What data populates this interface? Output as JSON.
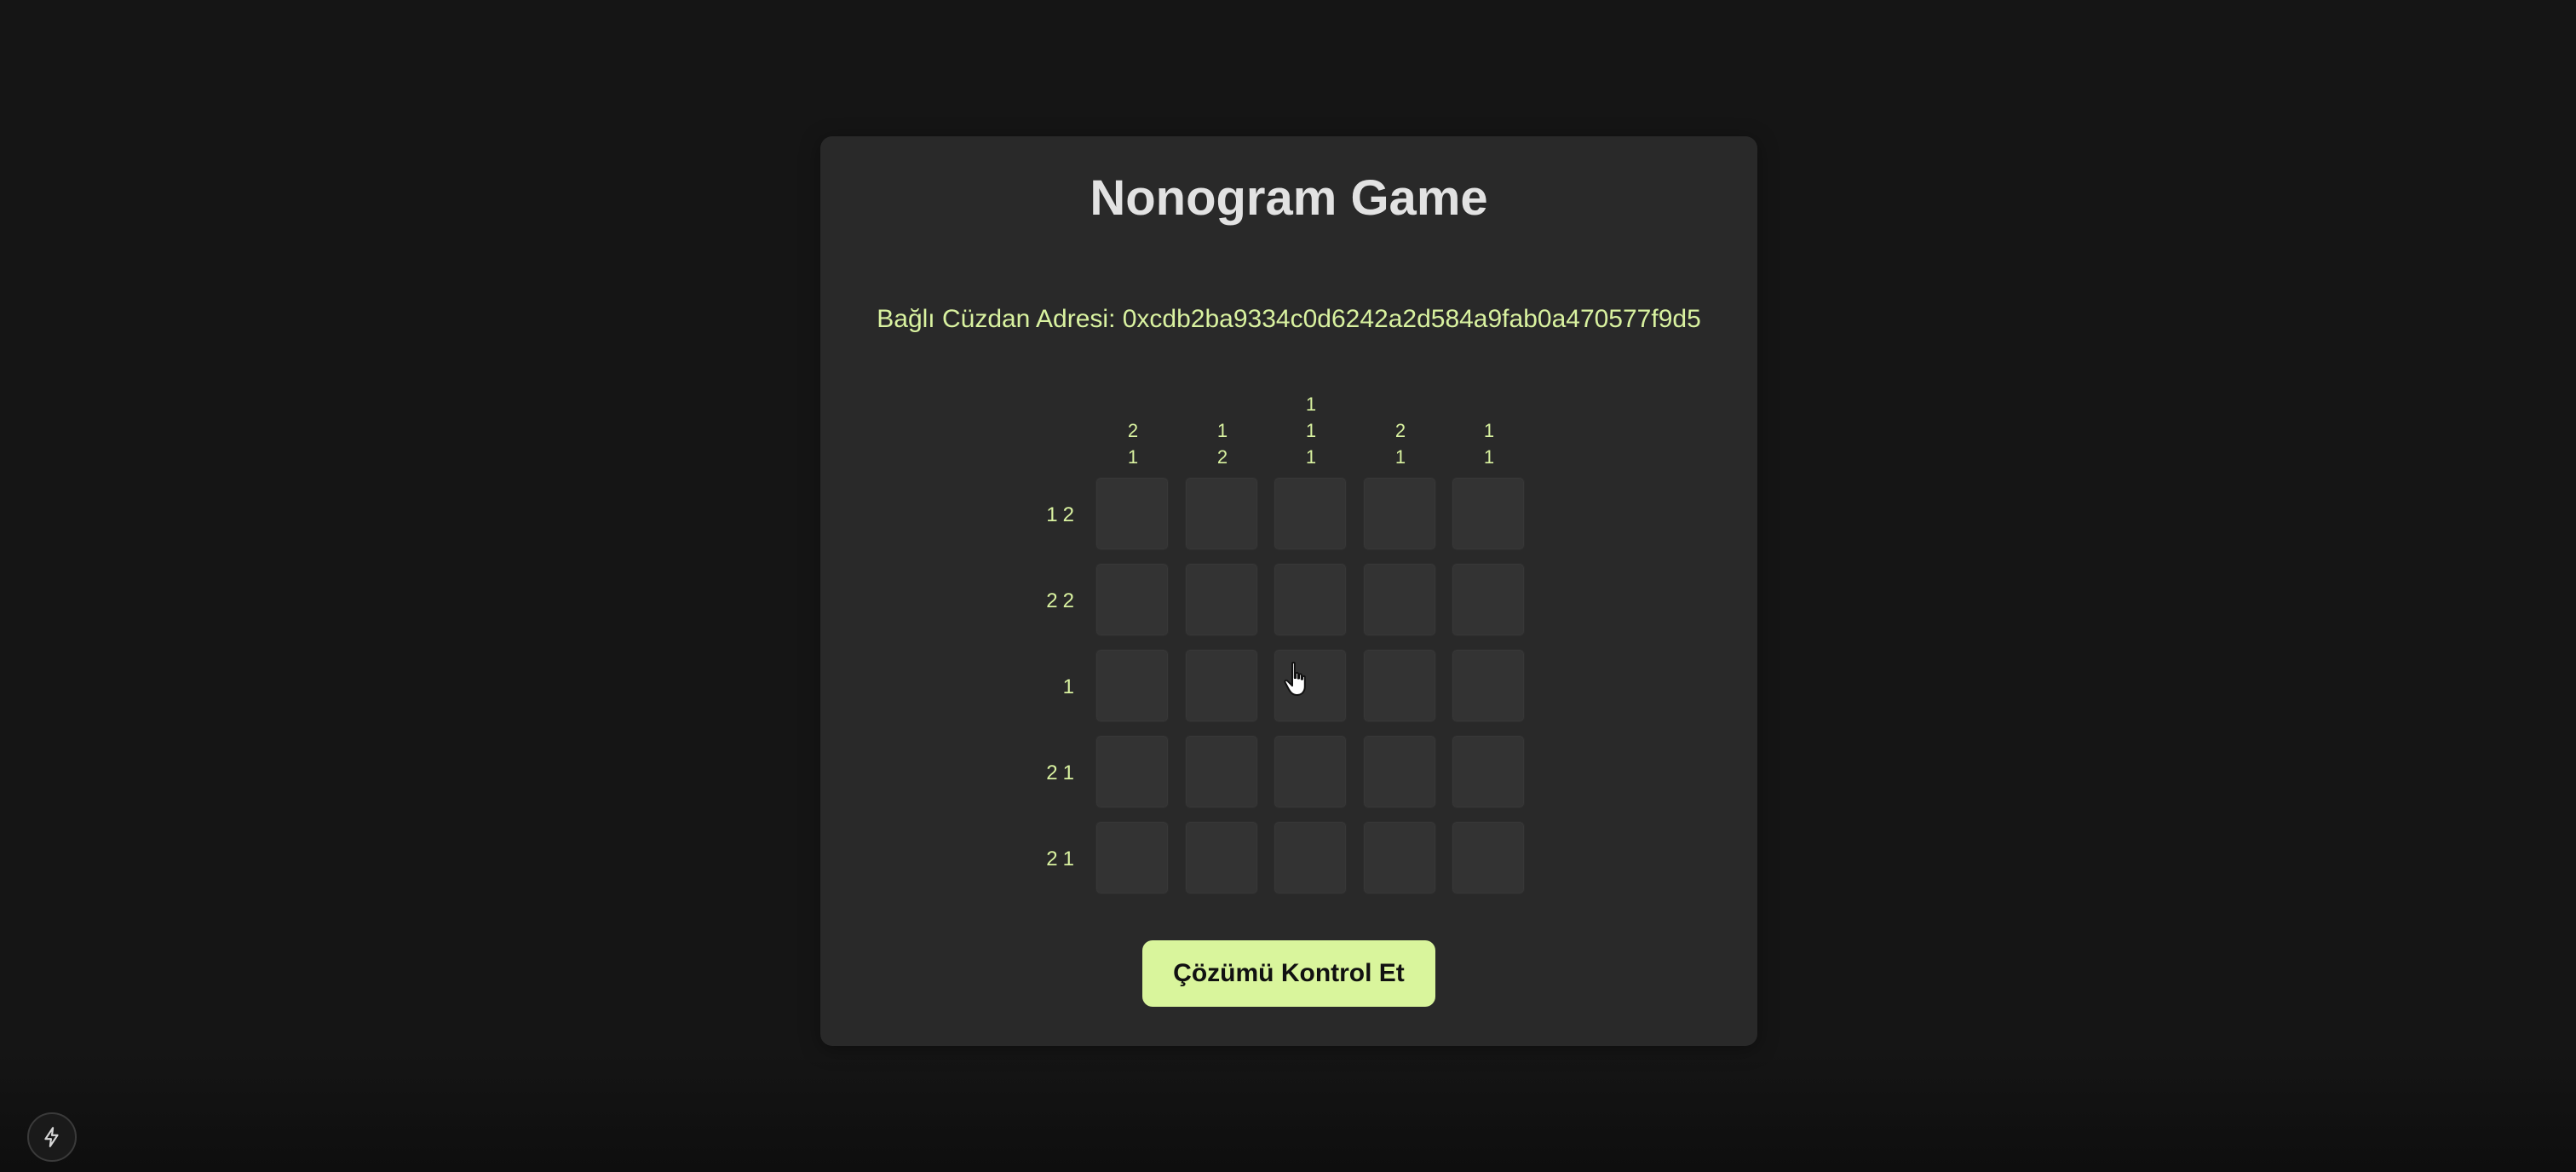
{
  "app": {
    "title": "Nonogram Game",
    "wallet_text": "Bağlı Cüzdan Adresi: 0xcdb2ba9334c0d6242a2d584a9fab0a470577f9d5"
  },
  "puzzle": {
    "size": 5,
    "column_clues": [
      [
        "2",
        "1"
      ],
      [
        "1",
        "2"
      ],
      [
        "1",
        "1",
        "1"
      ],
      [
        "2",
        "1"
      ],
      [
        "1",
        "1"
      ]
    ],
    "row_clues": [
      [
        "1",
        "2"
      ],
      [
        "2",
        "2"
      ],
      [
        "1"
      ],
      [
        "2",
        "1"
      ],
      [
        "2",
        "1"
      ]
    ],
    "filled_cells": []
  },
  "actions": {
    "check_label": "Çözümü Kontrol Et"
  },
  "colors": {
    "background": "#151515",
    "card": "#292929",
    "cell": "#333333",
    "accent": "#d9f2a0",
    "button": "#d9f59c",
    "title": "#e2e2e2"
  },
  "icons": {
    "corner": "lightning-icon",
    "cursor": "hand-pointer-icon"
  }
}
